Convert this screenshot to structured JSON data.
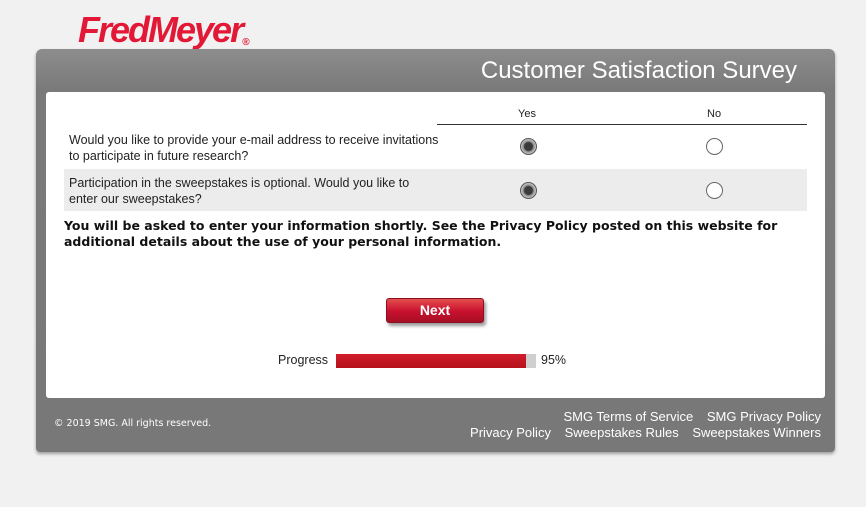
{
  "brand": {
    "logo_text": "FredMeyer",
    "reg_mark": "®",
    "logo_color": "#e31837"
  },
  "header": {
    "title": "Customer Satisfaction Survey"
  },
  "survey": {
    "columns": [
      "Yes",
      "No"
    ],
    "questions": [
      {
        "text": "Would you like to provide your e-mail address to receive invitations to participate in future research?",
        "selected": "Yes"
      },
      {
        "text": "Participation in the sweepstakes is optional. Would you like to enter our sweepstakes?",
        "selected": "Yes"
      }
    ],
    "notice": "You will be asked to enter your information shortly. See the Privacy Policy posted on this website for additional details about the use of your personal information."
  },
  "actions": {
    "next_label": "Next"
  },
  "progress": {
    "label": "Progress",
    "value_text": "95%",
    "fraction": 0.95
  },
  "footer": {
    "copyright": "© 2019 SMG. All rights reserved.",
    "links_row1": [
      "SMG Terms of Service",
      "SMG Privacy Policy"
    ],
    "links_row2": [
      "Privacy Policy",
      "Sweepstakes Rules",
      "Sweepstakes Winners"
    ]
  }
}
